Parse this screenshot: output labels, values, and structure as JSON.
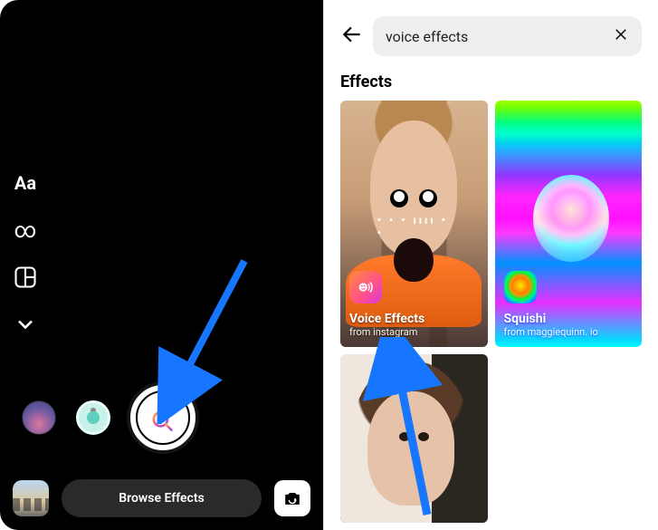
{
  "left": {
    "tools": {
      "text_label": "Aa",
      "boomerang_icon": "infinity-icon",
      "layout_icon": "layout-icon",
      "more_icon": "chevron-down-icon"
    },
    "filters": {
      "thumb1": "sunset-filter",
      "thumb2": "mint-camera-filter",
      "capture": "effects-capture"
    },
    "browse_label": "Browse Effects",
    "gallery_icon": "gallery-thumbnail",
    "flip_icon": "flip-camera-icon"
  },
  "right": {
    "search": {
      "query": "voice effects",
      "back_icon": "back-icon",
      "clear_icon": "close-icon"
    },
    "section_heading": "Effects",
    "cards": [
      {
        "title": "Voice Effects",
        "subtitle": "from instagram",
        "icon": "voice-effects-icon"
      },
      {
        "title": "Squishi",
        "subtitle": "from maggiequinn. io",
        "icon": "squishi-icon"
      },
      {
        "title": "",
        "subtitle": "",
        "icon": ""
      }
    ]
  },
  "annotations": {
    "arrow_color": "#1776ff"
  }
}
